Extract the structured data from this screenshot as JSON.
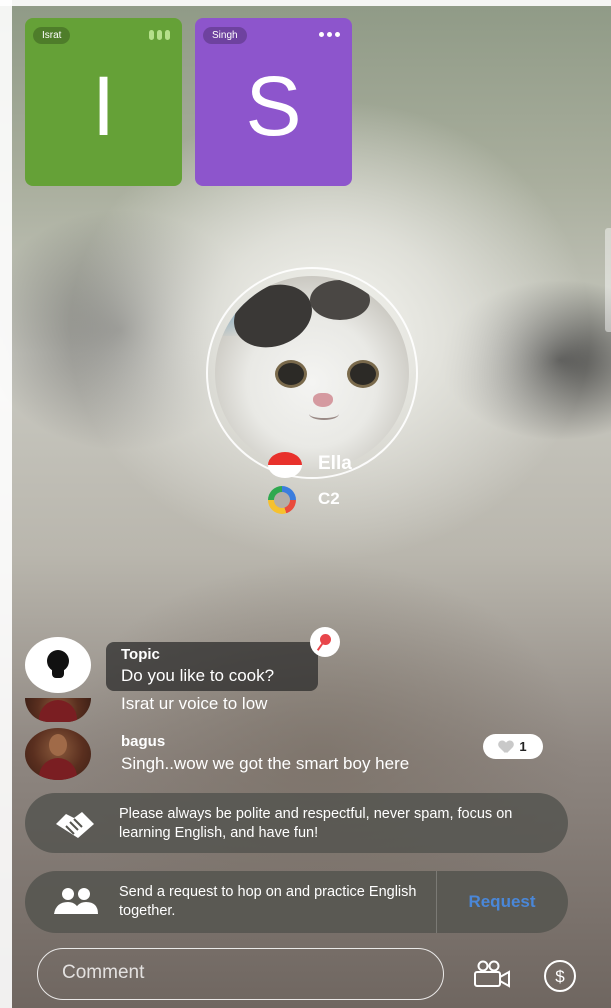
{
  "participants": [
    {
      "name": "Israt",
      "initial": "I",
      "color": "#65a137"
    },
    {
      "name": "Singh",
      "initial": "S",
      "color": "#8d55cc"
    }
  ],
  "host": {
    "name": "Ella",
    "level": "C2",
    "flag": "indonesia-flag-icon"
  },
  "topic": {
    "label": "Topic",
    "text": "Do you like to cook?"
  },
  "chat": [
    {
      "author": "",
      "text": "Israt ur voice to low"
    },
    {
      "author": "bagus",
      "text": "Singh..wow we got the smart boy here",
      "likes": "1"
    }
  ],
  "notice": {
    "text": "Please always be polite and respectful, never spam, focus on learning English, and have fun!"
  },
  "request": {
    "text": "Send a request to hop on and practice English together.",
    "button": "Request"
  },
  "composer": {
    "placeholder": "Comment"
  },
  "colors": {
    "accent": "#4a87d8",
    "pin": "#e8464b"
  }
}
